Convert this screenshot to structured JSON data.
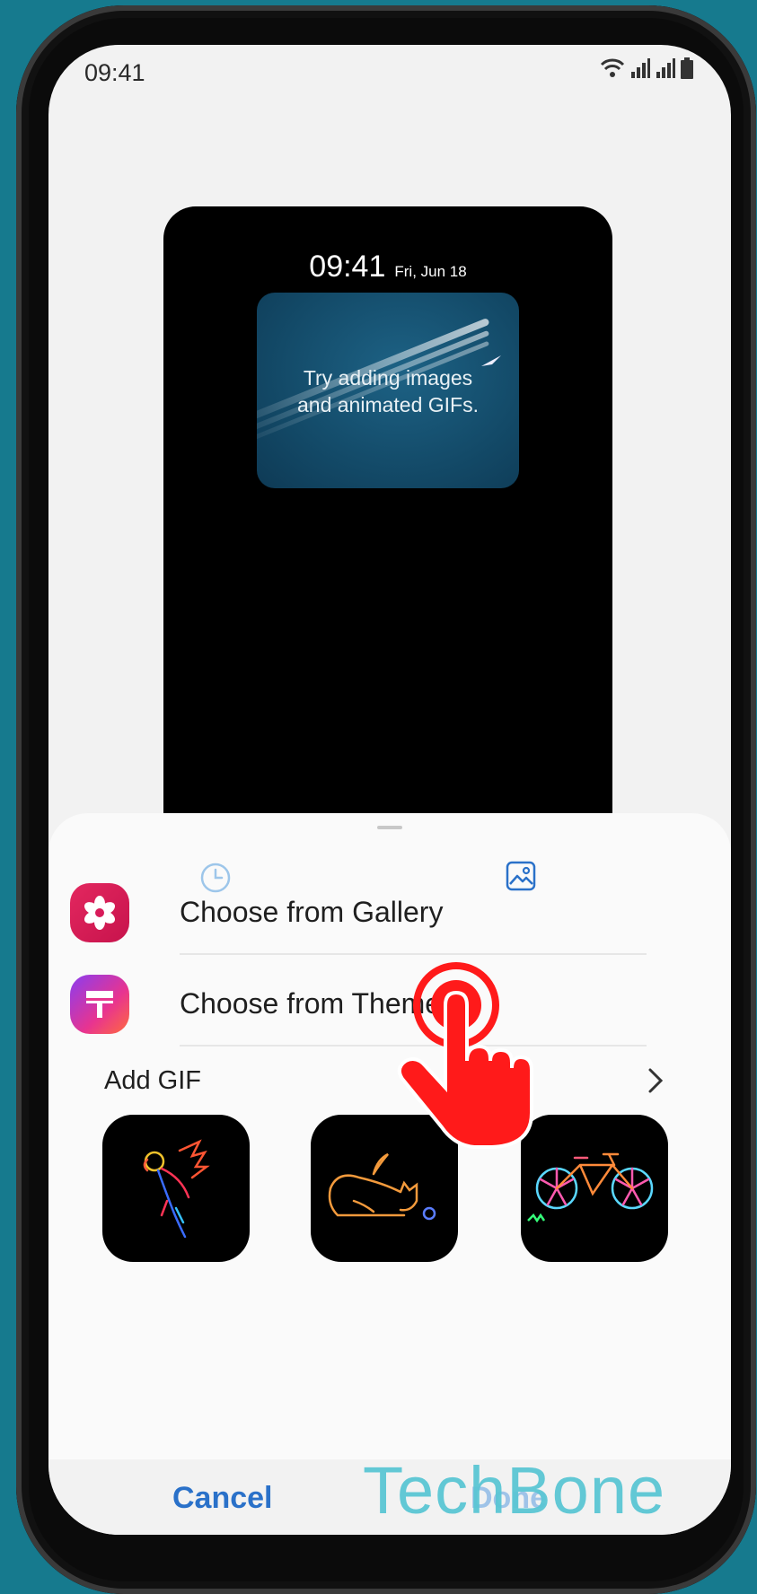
{
  "status_bar": {
    "time": "09:41"
  },
  "lock_preview": {
    "time": "09:41",
    "date": "Fri, Jun 18",
    "hint_line1": "Try adding images",
    "hint_line2": "and animated GIFs."
  },
  "sheet": {
    "tabs": [
      {
        "icon": "clock-icon"
      },
      {
        "icon": "image-icon"
      }
    ],
    "options": [
      {
        "label": "Choose from Gallery",
        "icon": "gallery-flower-icon"
      },
      {
        "label": "Choose from Themes",
        "icon": "themes-brush-icon"
      }
    ],
    "add_gif": {
      "label": "Add GIF",
      "items": [
        "parrot-gif",
        "cat-gif",
        "bicycle-gif"
      ]
    }
  },
  "actions": {
    "cancel": "Cancel",
    "done": "Done"
  },
  "watermark": "TechBone",
  "colors": {
    "accent": "#2a71c9",
    "gallery_icon": "#d81b5a",
    "sheet_tab_inactive": "#9dc6ea",
    "hand_pointer": "#ff1a1a"
  }
}
